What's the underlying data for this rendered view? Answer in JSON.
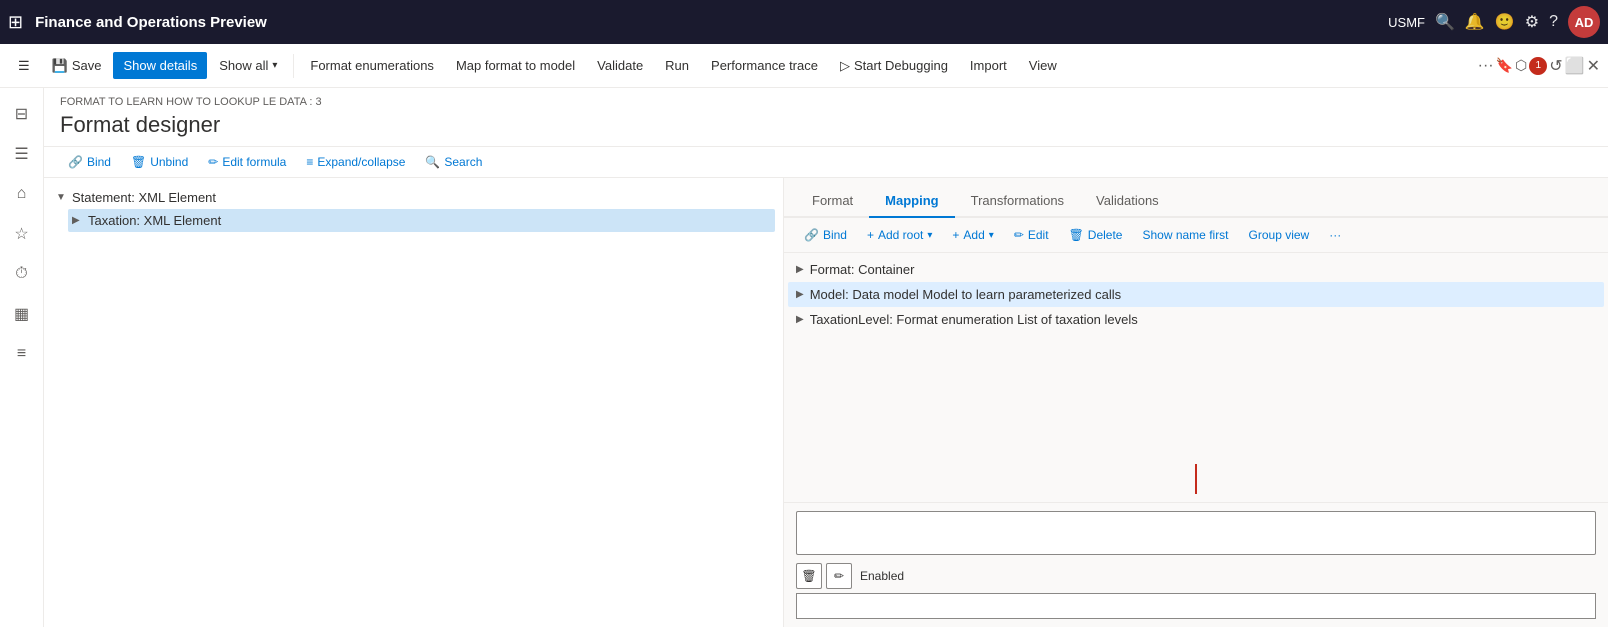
{
  "app": {
    "title": "Finance and Operations Preview",
    "user": "USMF",
    "avatar": "AD"
  },
  "command_bar": {
    "save_label": "Save",
    "show_details_label": "Show details",
    "show_all_label": "Show all",
    "format_enumerations_label": "Format enumerations",
    "map_format_to_model_label": "Map format to model",
    "validate_label": "Validate",
    "run_label": "Run",
    "performance_trace_label": "Performance trace",
    "start_debugging_label": "Start Debugging",
    "import_label": "Import",
    "view_label": "View"
  },
  "page": {
    "breadcrumb": "FORMAT TO LEARN HOW TO LOOKUP LE DATA : 3",
    "title": "Format designer"
  },
  "toolbar": {
    "bind_label": "Bind",
    "unbind_label": "Unbind",
    "edit_formula_label": "Edit formula",
    "expand_collapse_label": "Expand/collapse",
    "search_label": "Search"
  },
  "tree": {
    "items": [
      {
        "label": "Statement: XML Element",
        "level": 0,
        "expanded": true,
        "arrow": "▼"
      },
      {
        "label": "Taxation: XML Element",
        "level": 1,
        "expanded": false,
        "arrow": "▶",
        "selected": true
      }
    ]
  },
  "tabs": [
    {
      "id": "format",
      "label": "Format",
      "active": false
    },
    {
      "id": "mapping",
      "label": "Mapping",
      "active": true
    },
    {
      "id": "transformations",
      "label": "Transformations",
      "active": false
    },
    {
      "id": "validations",
      "label": "Validations",
      "active": false
    }
  ],
  "mapping_toolbar": {
    "bind_label": "Bind",
    "add_root_label": "Add root",
    "add_label": "Add",
    "edit_label": "Edit",
    "delete_label": "Delete",
    "show_name_first_label": "Show name first",
    "group_view_label": "Group view"
  },
  "data_sources": [
    {
      "label": "Format: Container",
      "arrow": "▶",
      "highlighted": false
    },
    {
      "label": "Model: Data model Model to learn parameterized calls",
      "arrow": "▶",
      "highlighted": true
    },
    {
      "label": "TaxationLevel: Format enumeration List of taxation levels",
      "arrow": "▶",
      "highlighted": false
    }
  ],
  "bottom": {
    "enabled_label": "Enabled",
    "delete_icon": "🗑",
    "edit_icon": "✏"
  },
  "sidebar_icons": [
    {
      "name": "menu-icon",
      "symbol": "☰"
    },
    {
      "name": "home-icon",
      "symbol": "⌂"
    },
    {
      "name": "star-icon",
      "symbol": "★"
    },
    {
      "name": "clock-icon",
      "symbol": "⏱"
    },
    {
      "name": "calendar-icon",
      "symbol": "▦"
    },
    {
      "name": "list-icon",
      "symbol": "≡"
    }
  ]
}
